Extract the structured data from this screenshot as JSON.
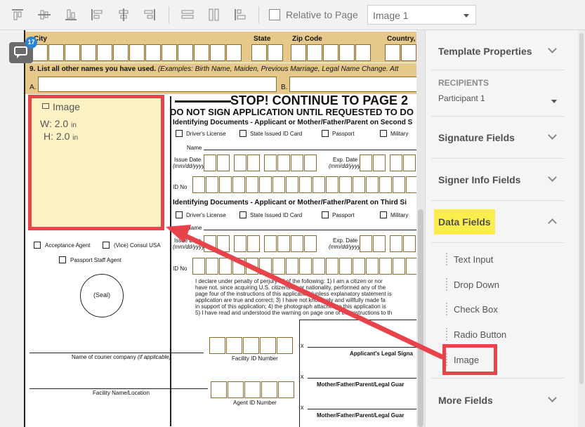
{
  "toolbar": {
    "icons": [
      "align-top-icon",
      "align-middle-icon",
      "align-bottom-icon",
      "align-left-icon",
      "align-center-icon",
      "align-right-icon",
      "distribute-horizontal-icon",
      "distribute-vertical-icon",
      "match-size-icon"
    ],
    "relative_label": "Relative to Page",
    "relative_checked": false,
    "image_select_value": "Image 1"
  },
  "document": {
    "row_labels": {
      "city": "City",
      "state": "State",
      "zip": "Zip Code",
      "country": "Country,"
    },
    "q9": "9.  List all other names you have used.",
    "q9_examples": "(Examples: Birth Name, Maiden, Previous Marriage, Legal Name Change.  Att",
    "q9_a": "A.",
    "q9_b": "B.",
    "image_field": {
      "title": "Image",
      "w_label": "W:",
      "w_value": "2.0",
      "h_label": "H:",
      "h_value": "2.0",
      "unit": "in"
    },
    "stop_title": "STOP! CONTINUE TO PAGE 2",
    "do_not_sign": "DO NOT SIGN APPLICATION UNTIL REQUESTED TO DO S",
    "id_docs_second": "Identifying Documents - Applicant or Mother/Father/Parent on Second S",
    "id_docs_third": "Identifying Documents - Applicant or Mother/Father/Parent on Third Si",
    "doc_types": [
      "Driver's License",
      "State Issued ID Card",
      "Passport",
      "Military"
    ],
    "name_label": "Name",
    "issue_date": "Issue Date",
    "date_format": "(mm/dd/yyyy)",
    "exp_date": "Exp. Date",
    "id_no": "ID No",
    "acceptance_agent": "Acceptance Agent",
    "vice_consul": "(Vice) Consul USA",
    "passport_staff": "Passport Staff Agent",
    "seal": "(Seal)",
    "declaration": [
      "I declare under penalty of perjury all of the following: 1) I am a citizen or nor",
      "have not, since acquiring U.S. citizenship or nationality, performed any of the",
      "page four of the instructions of this application (unless explanatory statement is",
      "application are true and correct; 3) I have not knowingly and willfully made fa",
      "in support of this application; 4) the photograph attached to this application is",
      "5) I have read and understood the warning on page one of the instructions to th"
    ],
    "courier_label": "Name of courier company",
    "courier_applicable": "(if applicable)",
    "facility_id": "Facility ID Number",
    "facility_name": "Facility Name/Location",
    "agent_id": "Agent ID Number",
    "x_mark": "x",
    "applicant_sig": "Applicant's Legal Signa",
    "parent_sig": "Mother/Father/Parent/Legal Guar"
  },
  "badge": {
    "count": "17"
  },
  "panel": {
    "template_properties": "Template Properties",
    "recipients_label": "RECIPIENTS",
    "recipient_value": "Participant 1",
    "signature_fields": "Signature Fields",
    "signer_info_fields": "Signer Info Fields",
    "data_fields": "Data Fields",
    "data_items": [
      "Text Input",
      "Drop Down",
      "Check Box",
      "Radio Button",
      "Image"
    ],
    "more_fields": "More Fields"
  },
  "colors": {
    "highlight_red": "#e8424b",
    "highlight_yellow": "#fbee4c",
    "image_fill": "#fdf2c4",
    "form_tan": "#e6c98a"
  }
}
